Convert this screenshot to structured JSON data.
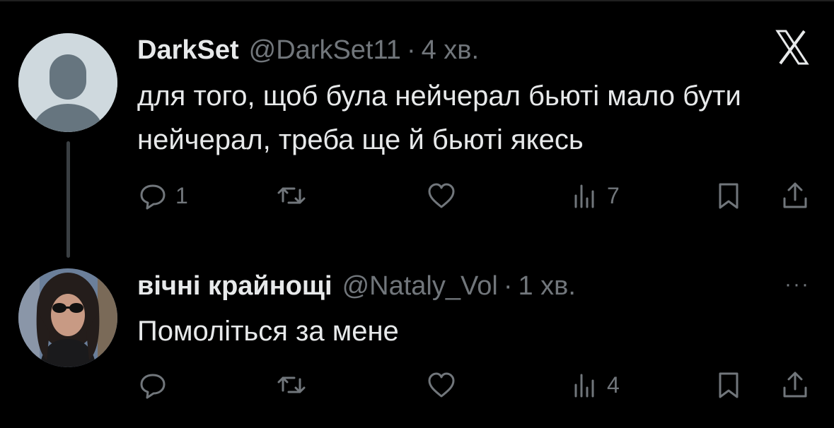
{
  "tweets": [
    {
      "name": "DarkSet",
      "handle": "@DarkSet11",
      "separator": "·",
      "time": "4 хв.",
      "text": "для того, щоб була нейчерал бьюті мало бути нейчерал, треба ще й бьюті якесь",
      "reply_count": "1",
      "views_count": "7"
    },
    {
      "name": "вічні крайнощі",
      "handle": "@Nataly_Vol",
      "separator": "·",
      "time": "1 хв.",
      "text": "Помоліться за мене",
      "more_label": "···",
      "reply_count": "",
      "views_count": "4"
    }
  ],
  "colors": {
    "background": "#000000",
    "text_primary": "#e7e9ea",
    "text_secondary": "#71767b",
    "default_avatar": "#cfd9de"
  },
  "icons": [
    "x-logo-icon",
    "reply-icon",
    "retweet-icon",
    "like-icon",
    "views-icon",
    "bookmark-icon",
    "share-icon",
    "more-icon"
  ]
}
